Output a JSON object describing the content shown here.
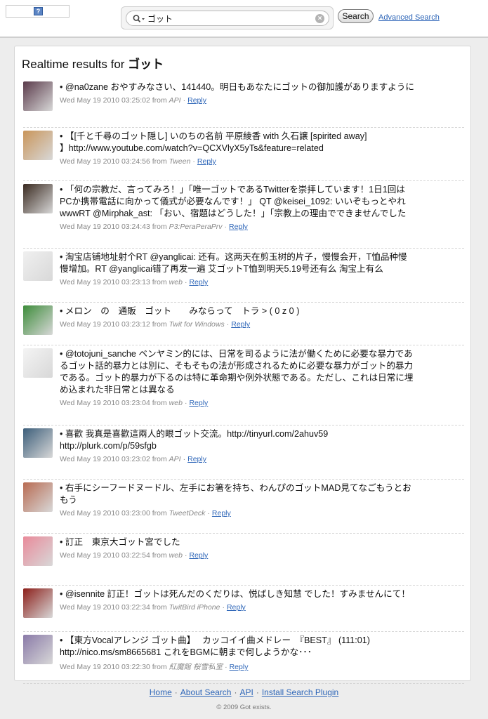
{
  "header": {
    "logo_glyph": "?",
    "search_value": "ゴット",
    "search_button_label": "Search",
    "advanced_link": "Advanced Search"
  },
  "results": {
    "heading_prefix": "Realtime results for",
    "heading_query": "ゴット",
    "reply_label": "Reply",
    "from_word": "from",
    "tweets": [
      {
        "lines": [
          "• @na0zane おやすみなさい、141440。明日もあなたにゴットの御加護がありますように"
        ],
        "date": "Wed May 19 2010 03:25:02",
        "source": "API",
        "avatar": "avatar-anime-girl",
        "avatar_color": "#5a3a4a"
      },
      {
        "lines": [
          "• 【[千と千尋のゴット隠し] いのちの名前 平原綾香 with 久石譲 [spirited away]",
          "】http://www.youtube.com/watch?v=QCXVlyX5yTs&feature=related"
        ],
        "date": "Wed May 19 2010 03:24:56",
        "source": "Tween",
        "avatar": "avatar-creature",
        "avatar_color": "#c9955a"
      },
      {
        "lines": [
          "• 「何の宗教だ、言ってみろ！」「唯一ゴットであるTwitterを崇拝しています！1日1回は",
          "PCか携帯電話に向かって儀式が必要なんです！」 QT @keisei_1092: いいぞもっとやれ",
          "wwwRT @Mirphak_ast: 「おい、宿題はどうした！」「宗教上の理由でできませんでした"
        ],
        "date": "Wed May 19 2010 03:24:43",
        "source": "P3:PeraPeraPrv",
        "avatar": "avatar-character",
        "avatar_color": "#3a2a20"
      },
      {
        "lines": [
          "• 淘宝店铺地址射个RT @yanglicai: 还有。这两天在剪玉树的片子，慢慢会开，T恤品种慢",
          "慢增加。RT @yanglicai错了再发一遍 艾ゴットT恤到明天5.19号还有么 淘宝上有么"
        ],
        "date": "Wed May 19 2010 03:23:13",
        "source": "web",
        "avatar": "avatar-yellow-ribbon",
        "avatar_color": "#f0f0f0"
      },
      {
        "lines": [
          "• メロン　の　通販　ゴット　　みならって　トラ > ( 0 z 0 )"
        ],
        "date": "Wed May 19 2010 03:23:12",
        "source": "Twit for Windows",
        "avatar": "avatar-green-hair",
        "avatar_color": "#3d8c3a"
      },
      {
        "lines": [
          "• @totojuni_sanche ベンヤミン的には、日常を司るように法が働くために必要な暴力であ",
          "るゴット話的暴力とは別に、そもそもの法が形成されるために必要な暴力がゴット的暴力",
          "である。ゴット的暴力が下るのは特に革命期や例外状態である。ただし、これは日常に埋",
          "め込まれた非日常とは異なる"
        ],
        "date": "Wed May 19 2010 03:23:04",
        "source": "web",
        "avatar": "avatar-sketch",
        "avatar_color": "#f4f4f4"
      },
      {
        "lines": [
          "• 喜歡 我真是喜歡這兩人的眼ゴット交流。http://tinyurl.com/2ahuv59",
          "http://plurk.com/p/59sfgb"
        ],
        "date": "Wed May 19 2010 03:23:02",
        "source": "API",
        "avatar": "avatar-plush",
        "avatar_color": "#3c5e7a"
      },
      {
        "lines": [
          "• 右手にシーフードヌードル、左手にお箸を持ち、わんぴのゴットMAD見てなごもうとお",
          "もう"
        ],
        "date": "Wed May 19 2010 03:23:00",
        "source": "TweetDeck",
        "avatar": "avatar-anime-boy",
        "avatar_color": "#b86b52"
      },
      {
        "lines": [
          "• 訂正　東京大ゴット宮でした"
        ],
        "date": "Wed May 19 2010 03:22:54",
        "source": "web",
        "avatar": "avatar-pink-blobs",
        "avatar_color": "#e98a9a"
      },
      {
        "lines": [
          "• @isennite 訂正！ゴットは死んだのくだりは、悦ばしき知慧 でした！すみませんにて！"
        ],
        "date": "Wed May 19 2010 03:22:34",
        "source": "TwitBird iPhone",
        "avatar": "avatar-mech",
        "avatar_color": "#8c1f1a"
      },
      {
        "lines": [
          "• 【東方Vocalアレンジ ゴット曲】　 カッコイイ曲メドレー　『BEST』 (111:01)",
          "http://nico.ms/sm8665681 これをBGMに朝まで何しようかな･･･"
        ],
        "date": "Wed May 19 2010 03:22:30",
        "source": "紅魔館 桜雪私室",
        "avatar": "avatar-maid",
        "avatar_color": "#8a7aa8"
      }
    ]
  },
  "footer": {
    "links": [
      "Home",
      "About Search",
      "API",
      "Install Search Plugin"
    ],
    "separator": "·",
    "copyright": "© 2009 Got exists."
  },
  "colors": {
    "link": "#2e66b8",
    "meta_text": "#888888",
    "page_background": "#ededed"
  }
}
